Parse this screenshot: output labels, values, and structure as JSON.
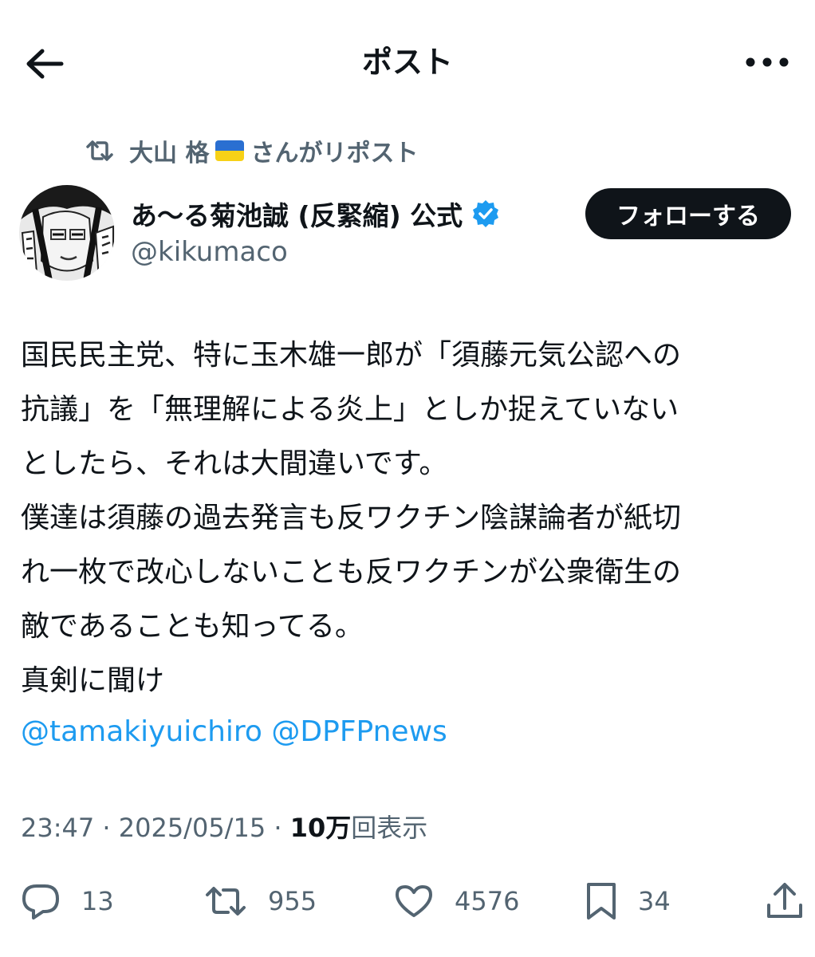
{
  "header": {
    "title": "ポスト"
  },
  "repost": {
    "prefix": "大山 格",
    "suffix": "さんがリポスト"
  },
  "author": {
    "name": "あ〜る菊池誠 (反緊縮) 公式",
    "handle": "@kikumaco",
    "verified_color": "#1d9bf0"
  },
  "follow_button": {
    "label": "フォローする"
  },
  "post": {
    "lines": [
      "国民民主党、特に玉木雄一郎が「須藤元気公認への",
      "抗議」を「無理解による炎上」としか捉えていない",
      "としたら、それは大間違いです。",
      "僕達は須藤の過去発言も反ワクチン陰謀論者が紙切",
      "れ一枚で改心しないことも反ワクチンが公衆衛生の",
      "敵であることも知ってる。",
      "真剣に聞け"
    ],
    "mentions": [
      "@tamakiyuichiro",
      "@DPFPnews"
    ]
  },
  "meta": {
    "time": "23:47",
    "separator": "·",
    "date": "2025/05/15",
    "views_count": "10万",
    "views_label": "回表示"
  },
  "actions": {
    "replies": "13",
    "reposts": "955",
    "likes": "4576",
    "bookmarks": "34"
  },
  "colors": {
    "accent": "#1d9bf0",
    "text": "#0f1419",
    "muted": "#536471"
  }
}
